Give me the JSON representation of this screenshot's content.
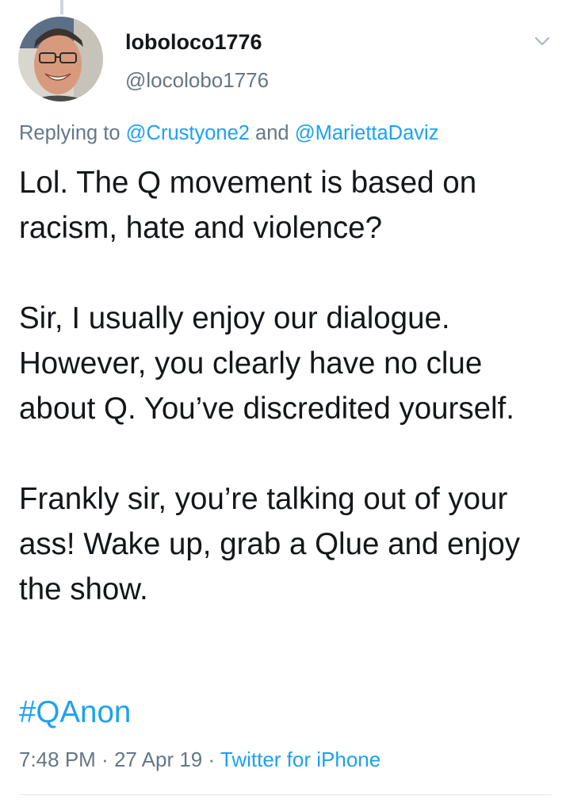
{
  "tweet": {
    "display_name": "loboloco1776",
    "handle": "@locolobo1776",
    "avatar_icon": "user-avatar-photo",
    "menu_icon": "chevron-down-icon",
    "reply_prefix": "Replying to ",
    "reply_mention_1": "@Crustyone2",
    "reply_joiner": " and ",
    "reply_mention_2": "@MariettaDaviz",
    "body": "Lol. The Q movement is based on racism, hate and violence?\n\nSir, I usually enjoy our dialogue. However, you clearly have no clue about Q. You’ve discredited yourself.\n\nFrankly sir, you’re talking out of your ass! Wake up, grab a Qlue and enjoy the show.",
    "hashtag": "#QAnon",
    "time": "7:48 PM",
    "separator_1": " · ",
    "date": "27 Apr 19",
    "separator_2": " · ",
    "source": "Twitter for iPhone"
  },
  "colors": {
    "link": "#1da1f2",
    "secondary_text": "#657786",
    "primary_text": "#14171a",
    "divider": "#e1e8ed"
  }
}
